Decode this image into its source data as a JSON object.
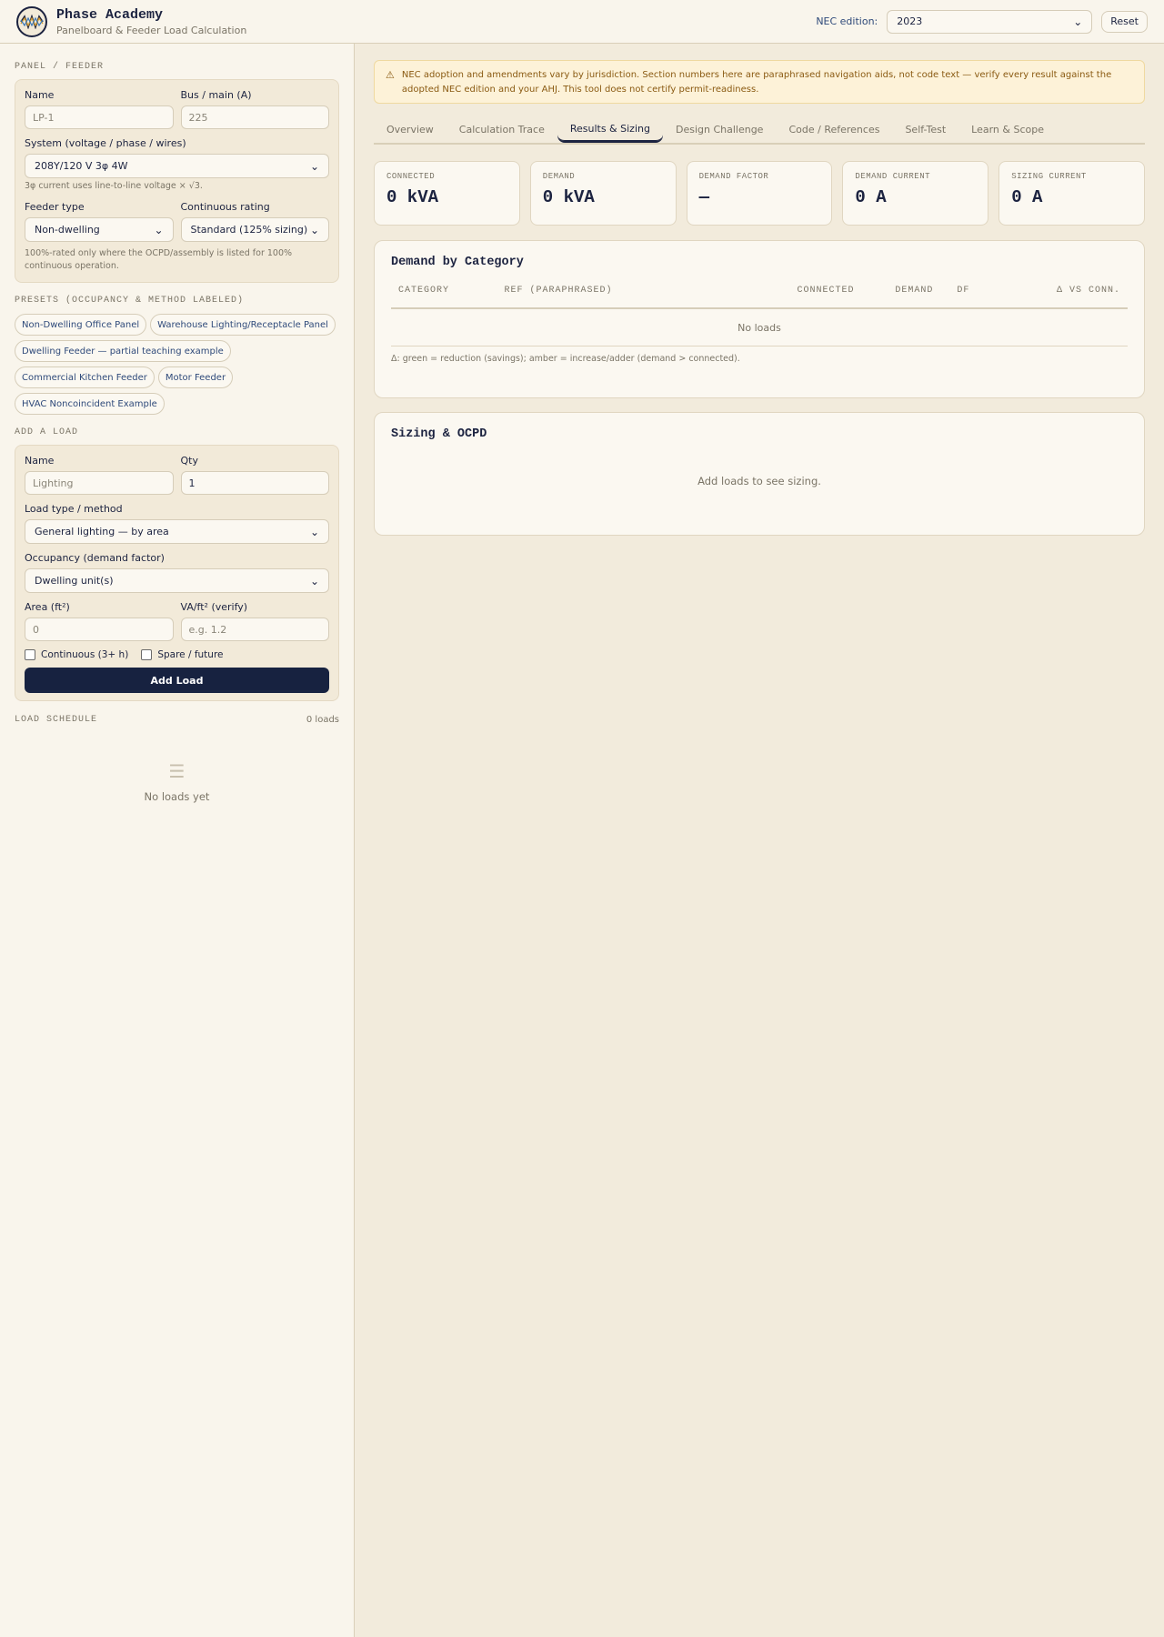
{
  "header": {
    "title": "Phase Academy",
    "subtitle": "Panelboard & Feeder Load Calculation",
    "nec_label": "NEC edition:",
    "nec_value": "2023",
    "reset_label": "Reset"
  },
  "sidebar": {
    "panel_section": "PANEL / FEEDER",
    "name_label": "Name",
    "name_placeholder": "LP-1",
    "bus_label": "Bus / main (A)",
    "bus_placeholder": "225",
    "system_label": "System (voltage / phase / wires)",
    "system_value": "208Y/120 V 3φ 4W",
    "system_hint": "3φ current uses line-to-line voltage × √3.",
    "feeder_type_label": "Feeder type",
    "feeder_type_value": "Non-dwelling",
    "continuous_rating_label": "Continuous rating",
    "continuous_rating_value": "Standard (125% sizing)",
    "rating_hint": "100%-rated only where the OCPD/assembly is listed for 100% continuous operation.",
    "presets_section": "PRESETS (OCCUPANCY & METHOD LABELED)",
    "presets": [
      "Non-Dwelling Office Panel",
      "Warehouse Lighting/Receptacle Panel",
      "Dwelling Feeder — partial teaching example",
      "Commercial Kitchen Feeder",
      "Motor Feeder",
      "HVAC Noncoincident Example"
    ],
    "add_load_section": "ADD A LOAD",
    "load_name_label": "Name",
    "load_name_placeholder": "Lighting",
    "qty_label": "Qty",
    "qty_value": "1",
    "load_type_label": "Load type / method",
    "load_type_value": "General lighting — by area",
    "occupancy_label": "Occupancy (demand factor)",
    "occupancy_value": "Dwelling unit(s)",
    "area_label": "Area (ft²)",
    "area_placeholder": "0",
    "vaft_label": "VA/ft² (verify)",
    "vaft_placeholder": "e.g. 1.2",
    "continuous_label": "Continuous (3+ h)",
    "spare_label": "Spare / future",
    "add_button": "Add Load",
    "schedule_section": "LOAD SCHEDULE",
    "schedule_count": "0 loads",
    "empty_text": "No loads yet"
  },
  "main": {
    "alert_icon": "⚠",
    "alert_text": "NEC adoption and amendments vary by jurisdiction. Section numbers here are paraphrased navigation aids, not code text — verify every result against the adopted NEC edition and your AHJ. This tool does not certify permit-readiness.",
    "tabs": [
      "Overview",
      "Calculation Trace",
      "Results & Sizing",
      "Design Challenge",
      "Code / References",
      "Self-Test",
      "Learn & Scope"
    ],
    "active_tab": "Results & Sizing",
    "stats": [
      {
        "label": "CONNECTED",
        "value": "0 kVA"
      },
      {
        "label": "DEMAND",
        "value": "0 kVA"
      },
      {
        "label": "DEMAND FACTOR",
        "value": "—"
      },
      {
        "label": "DEMAND CURRENT",
        "value": "0 A"
      },
      {
        "label": "SIZING CURRENT",
        "value": "0 A"
      }
    ],
    "demand_title": "Demand by Category",
    "table_headers": [
      "CATEGORY",
      "REF (PARAPHRASED)",
      "CONNECTED",
      "DEMAND",
      "DF",
      "Δ VS CONN."
    ],
    "no_loads": "No loads",
    "delta_note": "Δ: green = reduction (savings); amber = increase/adder (demand > connected).",
    "sizing_title": "Sizing & OCPD",
    "sizing_empty": "Add loads to see sizing."
  },
  "colors": {
    "accent": "#172240",
    "background": "#f9f5ec",
    "alert_bg": "#fdf2d8",
    "alert_text": "#8a5a12"
  }
}
